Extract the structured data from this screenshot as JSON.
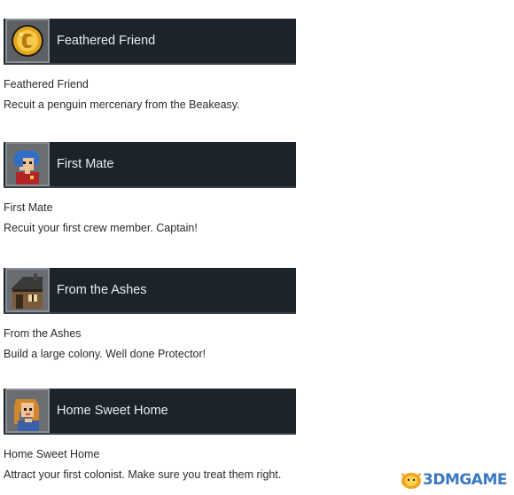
{
  "achievements": [
    {
      "banner_title": "Feathered Friend",
      "name": "Feathered Friend",
      "description": "Recuit a penguin mercenary from the Beakeasy.",
      "icon": "gold-coin-icon"
    },
    {
      "banner_title": "First Mate",
      "name": "First Mate",
      "description": "Recuit your first crew member. Captain!",
      "icon": "crew-member-portrait-icon"
    },
    {
      "banner_title": "From the Ashes",
      "name": "From the Ashes",
      "description": "Build a large colony. Well done Protector!",
      "icon": "house-icon"
    },
    {
      "banner_title": "Home Sweet Home",
      "name": "Home Sweet Home",
      "description": "Attract your first colonist. Make sure you treat them right.",
      "icon": "colonist-portrait-icon"
    }
  ],
  "watermark": {
    "text": "3DMGAME"
  },
  "colors": {
    "banner_bg": "#1c232b",
    "banner_text": "#e9eef2",
    "body_text": "#2a2a2a",
    "watermark": "#3a78c4"
  }
}
